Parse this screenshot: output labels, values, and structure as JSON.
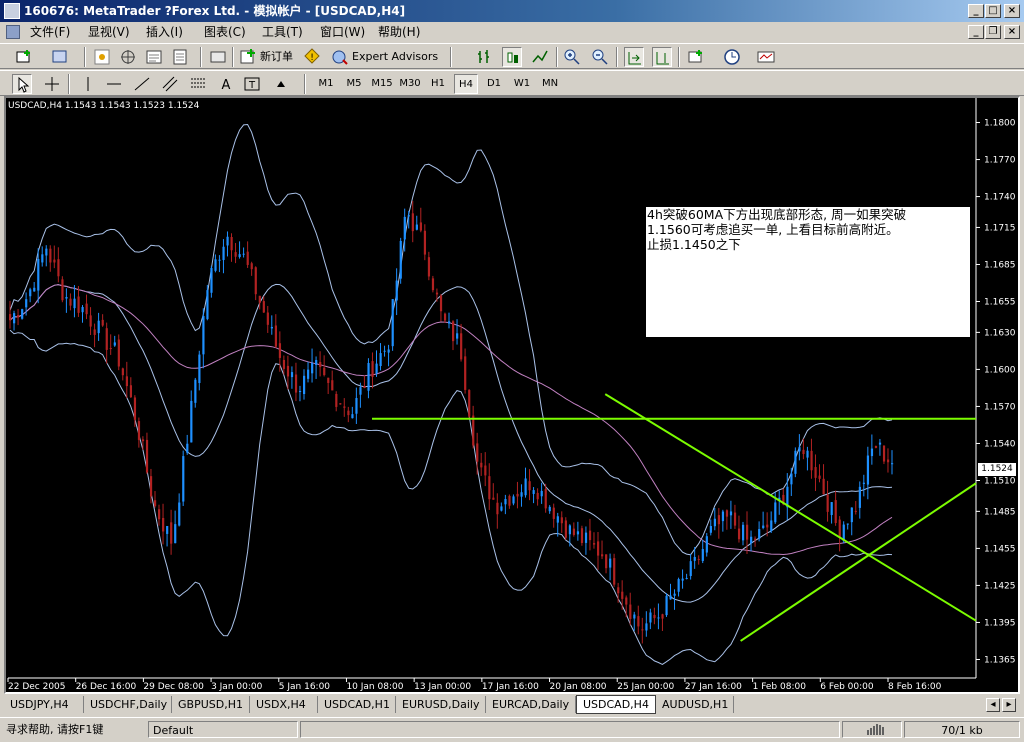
{
  "window": {
    "title": "160676: MetaTrader ?Forex Ltd. - 模拟帐户 - [USDCAD,H4]"
  },
  "menu": {
    "items": [
      "文件(F)",
      "显视(V)",
      "插入(I)",
      "图表(C)",
      "工具(T)",
      "窗口(W)",
      "帮助(H)"
    ]
  },
  "toolbar": {
    "new_order_label": "新订单",
    "expert_advisors_label": "Expert Advisors",
    "timeframes": [
      "M1",
      "M5",
      "M15",
      "M30",
      "H1",
      "H4",
      "D1",
      "W1",
      "MN"
    ],
    "active_timeframe": "H4"
  },
  "chart": {
    "header": "USDCAD,H4  1.1543 1.1543 1.1523 1.1524",
    "annotation_lines": [
      "4h突破60MA下方出现底部形态, 周一如果突破",
      "1.1560可考虑追买一单, 上看目标前高附近。",
      "止损1.1450之下"
    ],
    "current_price_label": "1.1524",
    "colors": {
      "background": "#000000",
      "bull_candle": "#1e90ff",
      "bear_candle": "#b22222",
      "bollinger": "#a9c1e8",
      "moving_average": "#c080c0",
      "trendline": "#7cfc00",
      "axis_text": "#ffffff"
    }
  },
  "chart_data": {
    "type": "candlestick",
    "y_ticks": [
      "1.1800",
      "1.1770",
      "1.1740",
      "1.1715",
      "1.1685",
      "1.1655",
      "1.1630",
      "1.1600",
      "1.1570",
      "1.1540",
      "1.1510",
      "1.1485",
      "1.1455",
      "1.1425",
      "1.1395",
      "1.1365"
    ],
    "x_ticks": [
      "22 Dec 2005",
      "26 Dec 16:00",
      "29 Dec 08:00",
      "3 Jan 00:00",
      "5 Jan 16:00",
      "10 Jan 08:00",
      "13 Jan 00:00",
      "17 Jan 16:00",
      "20 Jan 08:00",
      "25 Jan 00:00",
      "27 Jan 16:00",
      "1 Feb 08:00",
      "6 Feb 00:00",
      "8 Feb 16:00"
    ],
    "ylim": [
      1.135,
      1.1815
    ],
    "close_path": [
      1.164,
      1.166,
      1.17,
      1.166,
      1.165,
      1.163,
      1.161,
      1.156,
      1.149,
      1.146,
      1.156,
      1.167,
      1.171,
      1.169,
      1.165,
      1.161,
      1.1585,
      1.16,
      1.158,
      1.1565,
      1.16,
      1.162,
      1.173,
      1.17,
      1.164,
      1.162,
      1.152,
      1.149,
      1.15,
      1.151,
      1.149,
      1.147,
      1.146,
      1.145,
      1.142,
      1.139,
      1.14,
      1.142,
      1.144,
      1.147,
      1.148,
      1.146,
      1.147,
      1.15,
      1.154,
      1.151,
      1.147,
      1.149,
      1.154,
      1.1524
    ],
    "levels": [
      {
        "price": 1.156
      }
    ],
    "trendlines": [
      {
        "from": [
          "25 Jan 00:00",
          1.158
        ],
        "to": [
          "8 Feb 16:00",
          1.144
        ]
      },
      {
        "from": [
          "1 Feb 08:00",
          1.138
        ],
        "to": [
          "8 Feb 16:00",
          1.146
        ]
      }
    ]
  },
  "tabs": {
    "items": [
      "USDJPY,H4",
      "USDCHF,Daily",
      "GBPUSD,H1",
      "USDX,H4",
      "USDCAD,H1",
      "EURUSD,Daily",
      "EURCAD,Daily",
      "USDCAD,H4",
      "AUDUSD,H1"
    ],
    "active": "USDCAD,H4"
  },
  "status": {
    "help": "寻求帮助, 请按F1键",
    "profile": "Default",
    "traffic": "70/1 kb"
  }
}
